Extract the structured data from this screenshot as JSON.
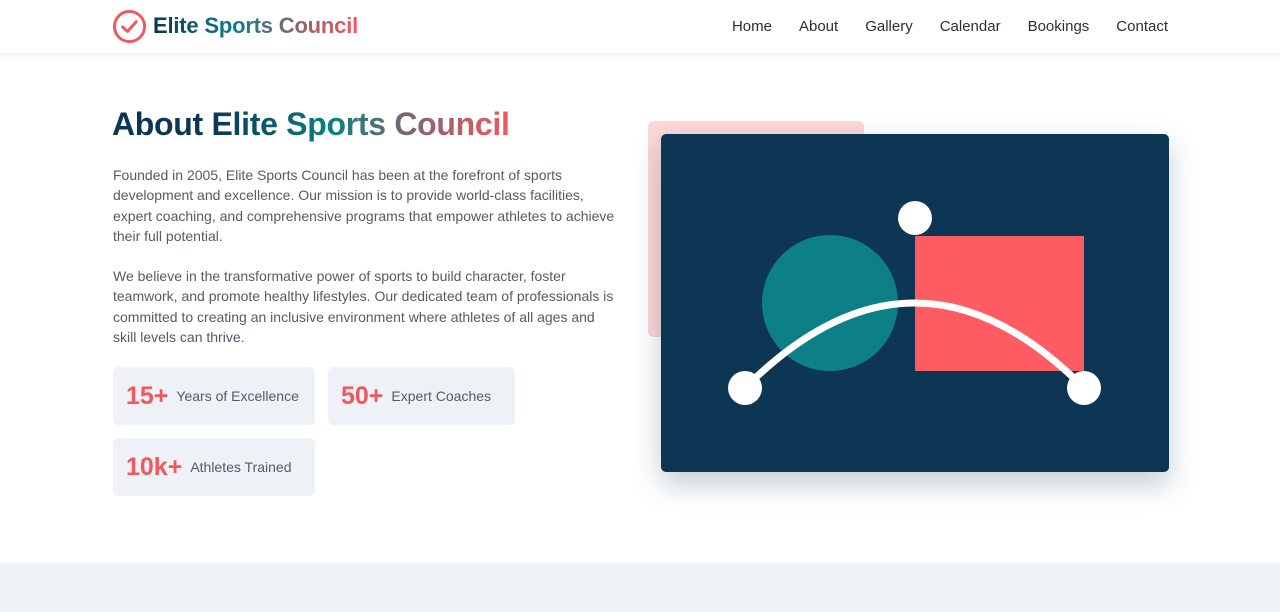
{
  "brand": {
    "name": "Elite Sports Council",
    "icon": "check-circle-icon",
    "gradient": [
      "#0c3653",
      "#0d7f86",
      "#8a6470",
      "#f2575f"
    ]
  },
  "nav": {
    "items": [
      {
        "label": "Home"
      },
      {
        "label": "About"
      },
      {
        "label": "Gallery"
      },
      {
        "label": "Calendar"
      },
      {
        "label": "Bookings"
      },
      {
        "label": "Contact"
      }
    ]
  },
  "about": {
    "title_prefix": "About",
    "title_highlight": "Elite Sports Council",
    "paragraphs": [
      "Founded in 2005, Elite Sports Council has been at the forefront of sports development and excellence. Our mission is to provide world-class facilities, expert coaching, and comprehensive programs that empower athletes to achieve their full potential.",
      "We believe in the transformative power of sports to build character, foster teamwork, and promote healthy lifestyles. Our dedicated team of professionals is committed to creating an inclusive environment where athletes of all ages and skill levels can thrive."
    ],
    "stats": [
      {
        "value": "15+",
        "label": "Years of Excellence"
      },
      {
        "value": "50+",
        "label": "Expert Coaches"
      },
      {
        "value": "10k+",
        "label": "Athletes Trained"
      }
    ]
  },
  "colors": {
    "navy": "#0c3653",
    "teal": "#0d7f86",
    "coral": "#f2575f",
    "blush": "#fbd8d9",
    "light_bg": "#eef2f6"
  },
  "illustration": {
    "icon": "abstract-shapes-illustration"
  }
}
